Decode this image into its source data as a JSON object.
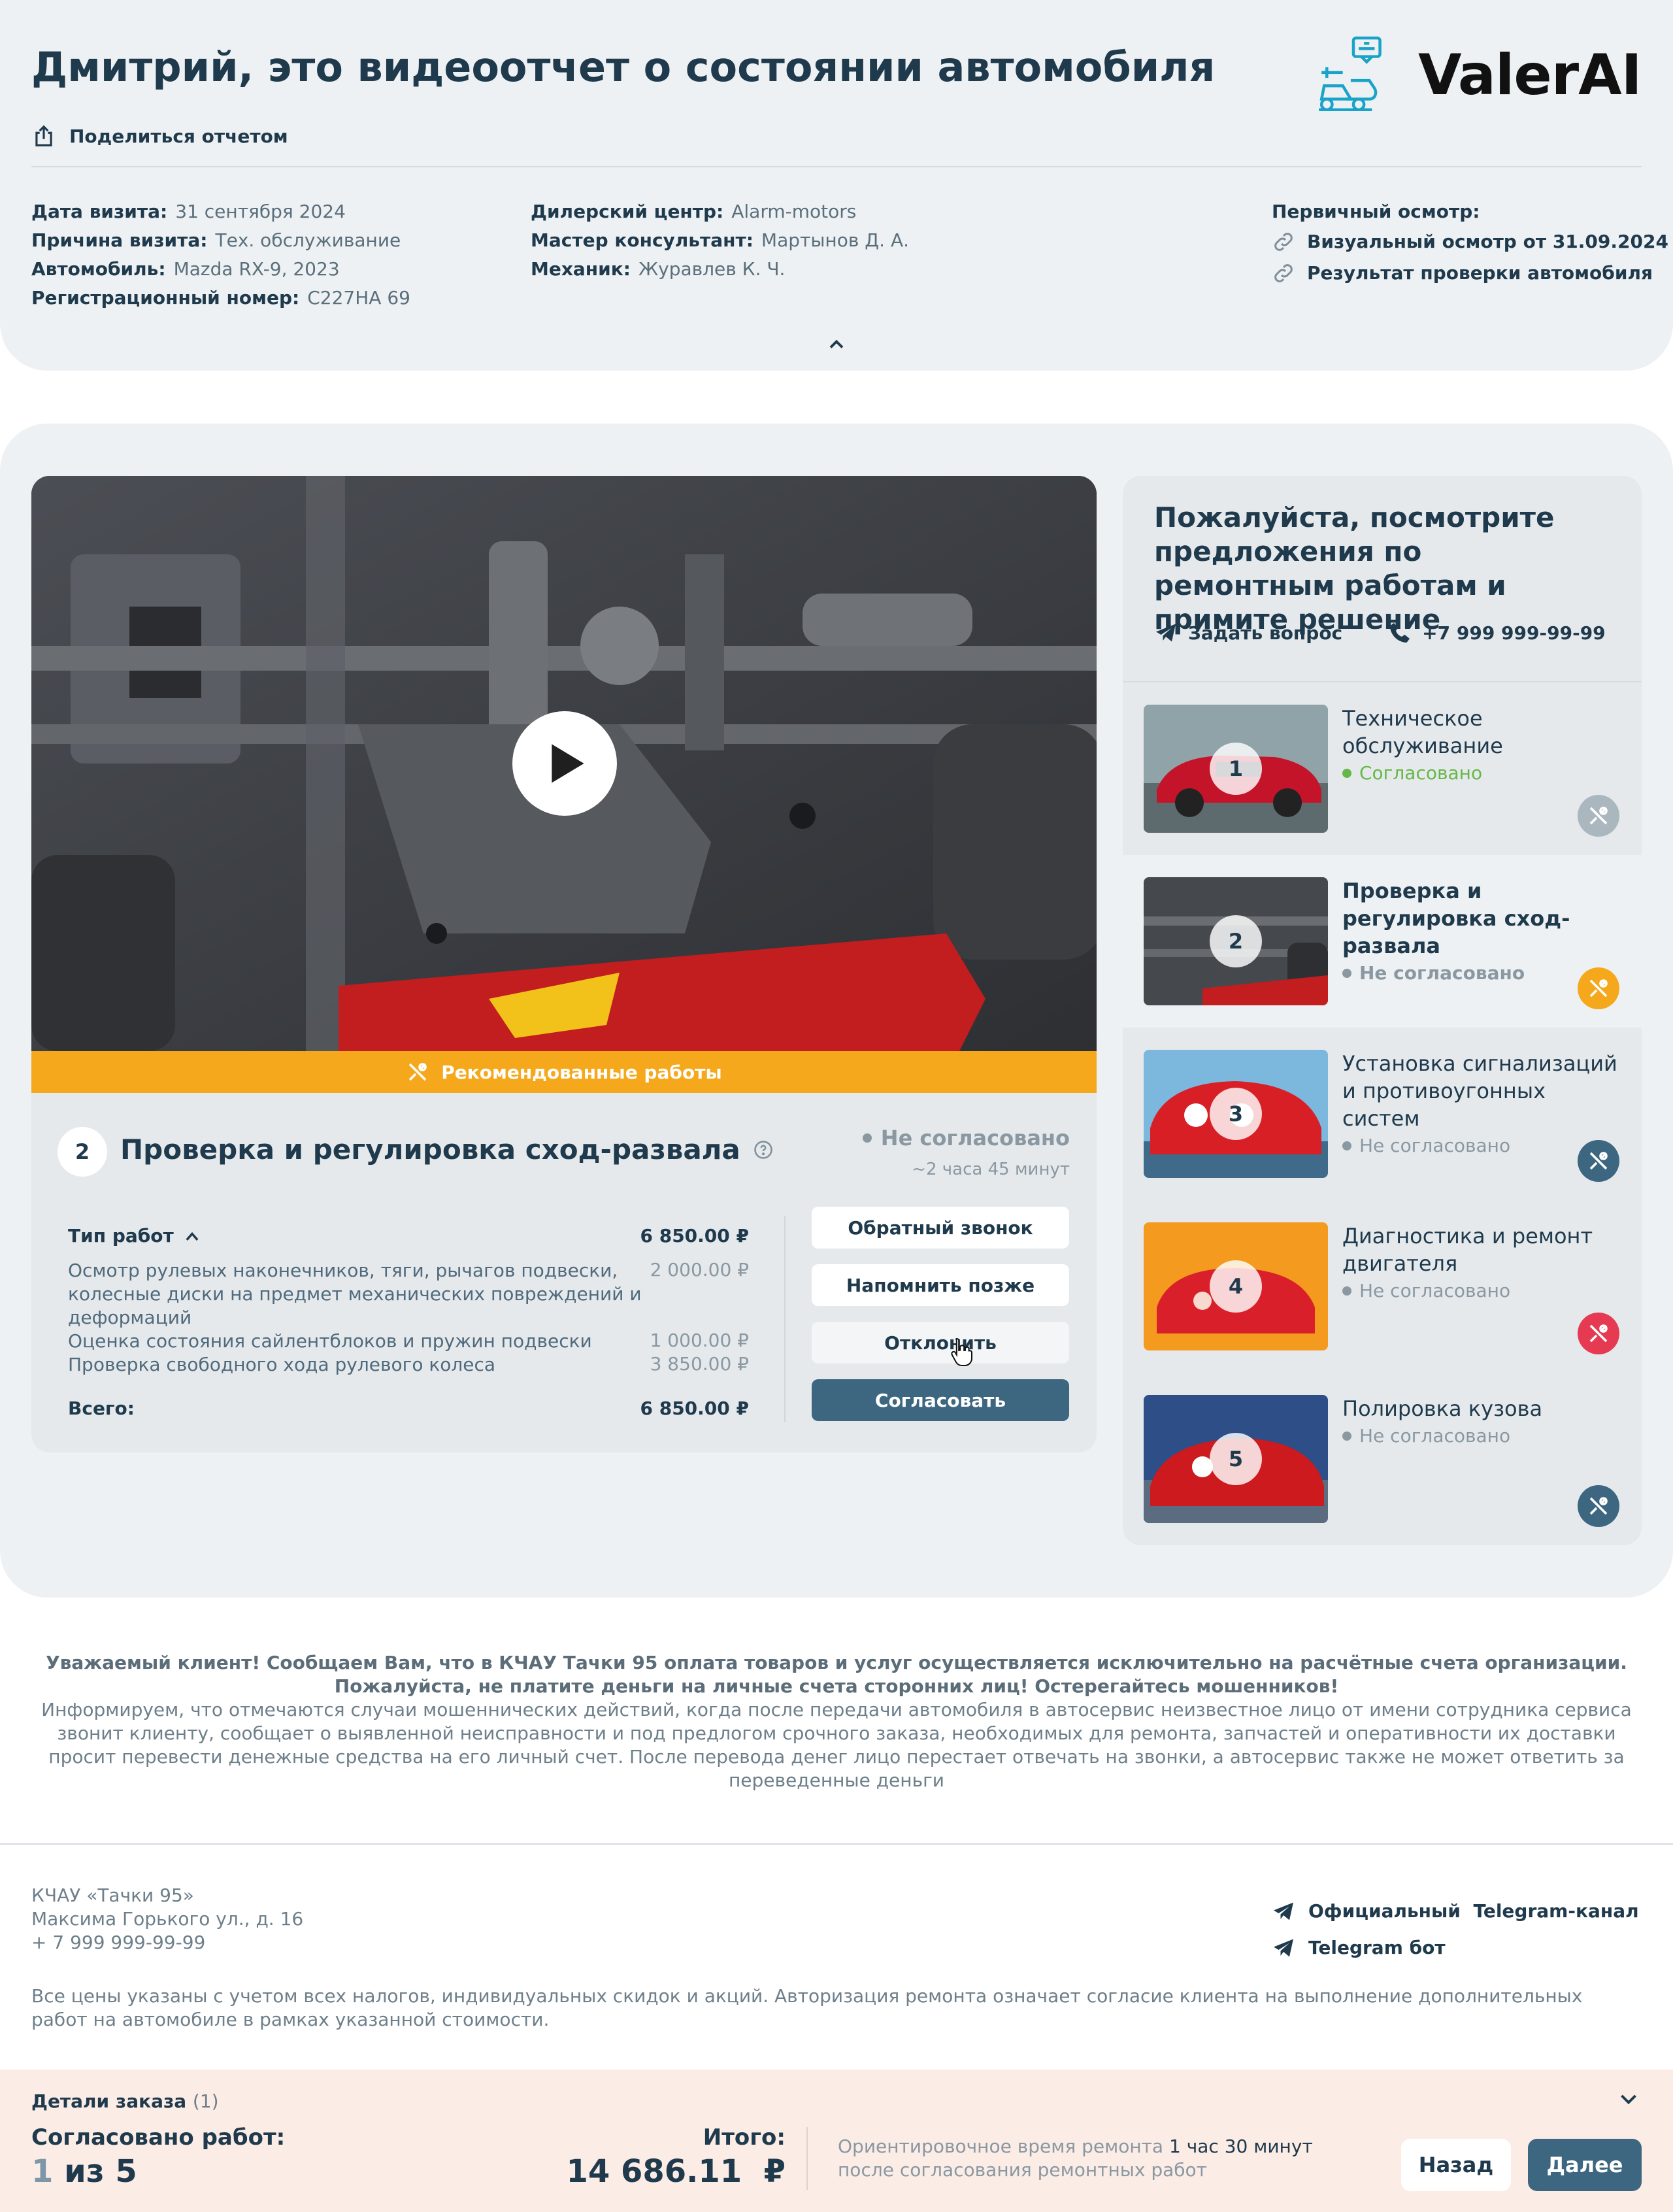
{
  "header": {
    "title": "Дмитрий, это видеоотчет о состоянии автомобиля",
    "share_label": "Поделиться отчетом",
    "logo_text": "ValerAI",
    "visit": [
      {
        "label": "Дата визита:",
        "value": "31 сентября 2024"
      },
      {
        "label": "Причина визита:",
        "value": "Тех. обслуживание"
      },
      {
        "label": "Автомобиль:",
        "value": "Mazda RX-9, 2023"
      },
      {
        "label": "Регистрационный номер:",
        "value": "С227НА 69"
      }
    ],
    "staff": [
      {
        "label": "Дилерский центр:",
        "value": "Alarm-motors"
      },
      {
        "label": "Мастер консультант:",
        "value": "Мартынов Д. А."
      },
      {
        "label": "Механик:",
        "value": "Журавлев К. Ч."
      }
    ],
    "primary_title": "Первичный осмотр:",
    "primary_links": [
      "Визуальный осмотр от 31.09.2024",
      "Результат проверки автомобиля"
    ]
  },
  "video": {
    "recommended_label": "Рекомендованные работы"
  },
  "job": {
    "number": "2",
    "title": "Проверка и регулировка сход-развала",
    "status": "Не согласовано",
    "time": "~2 часа 45 минут",
    "work_type_label": "Тип работ",
    "work_type_total": "6 850.00 ₽",
    "items": [
      {
        "name": "Осмотр рулевых наконечников, тяги, рычагов подвески, колесные диски на предмет механических повреждений и деформаций",
        "price": "2 000.00 ₽"
      },
      {
        "name": "Оценка состояния сайлентблоков и пружин подвески",
        "price": "1 000.00 ₽"
      },
      {
        "name": "Проверка свободного хода рулевого колеса",
        "price": "3 850.00 ₽"
      }
    ],
    "total_label": "Всего:",
    "total_value": "6 850.00 ₽",
    "buttons": {
      "callback": "Обратный звонок",
      "remind": "Напомнить позже",
      "reject": "Отклонить",
      "agree": "Согласовать"
    }
  },
  "sidebar": {
    "heading": "Пожалуйста, посмотрите предложения по ремонтным работам и примите решение",
    "ask_label": "Задать вопрос",
    "phone": "+7 999 999-99-99",
    "items": [
      {
        "n": "1",
        "name": "Техническое обслуживание",
        "status": "Согласовано",
        "badge_color": "#aab7bf"
      },
      {
        "n": "2",
        "name": "Проверка и регулировка сход-развала",
        "status": "Не согласовано",
        "badge_color": "#f6a81c"
      },
      {
        "n": "3",
        "name": "Установка сигнализаций и противоугонных систем",
        "status": "Не согласовано",
        "badge_color": "#3d6680"
      },
      {
        "n": "4",
        "name": "Диагностика и ремонт двигателя",
        "status": "Не согласовано",
        "badge_color": "#e63a52"
      },
      {
        "n": "5",
        "name": "Полировка кузова",
        "status": "Не согласовано",
        "badge_color": "#3d6680"
      }
    ]
  },
  "notice": {
    "bold": "Уважаемый клиент! Сообщаем Вам, что в КЧАУ Тачки 95 оплата товаров и услуг осуществляется исключительно на расчётные счета организации. Пожалуйста, не платите деньги на личные счета сторонних лиц! Остерегайтесь мошенников!",
    "text": "Информируем, что отмечаются случаи мошеннических действий, когда после передачи автомобиля в автосервис неизвестное лицо от имени сотрудника сервиса звонит клиенту, сообщает о выявленной неисправности и под предлогом срочного заказа, необходимых для ремонта, запчастей и оперативности их доставки просит перевести денежные средства на его личный счет. После перевода денег лицо перестает отвечать на звонки, а автосервис также не может ответить за переведенные деньги"
  },
  "contacts": {
    "company": "КЧАУ «Тачки 95»",
    "address": "Максима Горького ул., д. 16",
    "phone": "+ 7 999 999-99-99",
    "telegram_channel": "Официальный  Telegram-канал",
    "telegram_bot": "Telegram бот",
    "disclaimer": "Все цены указаны с учетом всех налогов, индивидуальных скидок и акций. Авторизация ремонта означает согласие клиента на выполнение дополнительных работ на автомобиле в рамках указанной стоимости."
  },
  "footer": {
    "details_label": "Детали заказа",
    "details_count": "(1)",
    "agreed_label": "Согласовано работ:",
    "agreed_done": "1",
    "agreed_rest": "из 5",
    "total_label": "Итого:",
    "total_value": "14 686.11  ₽",
    "eta_prefix": "Ориентировочное время ремонта",
    "eta_value": "1 час 30 минут",
    "eta_suffix": "после согласования ремонтных работ",
    "back": "Назад",
    "next": "Далее"
  }
}
